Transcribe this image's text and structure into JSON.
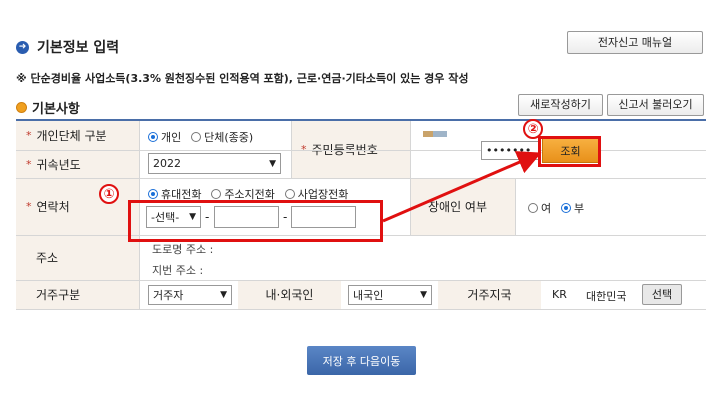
{
  "header": {
    "title": "기본정보 입력",
    "menu_button": "전자신고 매뉴얼",
    "note": "※ 단순경비율 사업소득(3.3% 원천징수된 인적용역 포함), 근로·연금·기타소득이 있는 경우 작성"
  },
  "section": {
    "title": "기본사항",
    "new_button": "새로작성하기",
    "load_button": "신고서 불러오기"
  },
  "form": {
    "taxpayer_type": {
      "label": "개인단체 구분",
      "options": [
        "개인",
        "단체(종중)"
      ],
      "selected": "개인"
    },
    "tax_year": {
      "label": "귀속년도",
      "value": "2022"
    },
    "resident_number": {
      "label": "주민등록번호",
      "masked_value": "•••••••",
      "search_button": "조회"
    },
    "contact": {
      "label": "연락처",
      "options": [
        "휴대전화",
        "주소지전화",
        "사업장전화"
      ],
      "selected": "휴대전화",
      "prefix_select": "-선택-",
      "separator": "-"
    },
    "disability": {
      "label": "장애인 여부",
      "options": [
        "여",
        "부"
      ],
      "selected": "부"
    },
    "address": {
      "label": "주소",
      "road": "도로명 주소 :",
      "lot": "지번 주소 :"
    },
    "residence_type": {
      "label": "거주구분",
      "value": "거주자"
    },
    "nationality_type": {
      "label": "내·외국인",
      "value": "내국인"
    },
    "residence_country": {
      "label": "거주지국",
      "code": "KR",
      "name": "대한민국",
      "select_button": "선택"
    }
  },
  "footer": {
    "save_button": "저장 후 다음이동"
  },
  "annotations": {
    "marker1": "①",
    "marker2": "②"
  },
  "colors": {
    "accent_blue": "#3b66a8",
    "header_bar": "#4a6ea8",
    "label_bg": "#f7f1ea",
    "search_orange": "#f0a020",
    "highlight_red": "#e01010"
  }
}
